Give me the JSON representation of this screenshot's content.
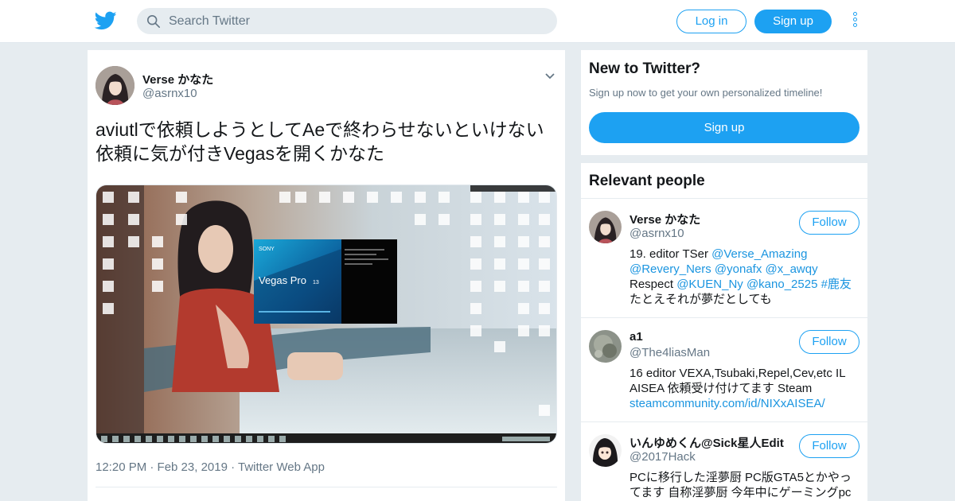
{
  "header": {
    "search_placeholder": "Search Twitter",
    "login_label": "Log in",
    "signup_label": "Sign up",
    "logo_icon": "twitter-bird-icon",
    "accent": "#1da1f2"
  },
  "tweet": {
    "author_name": "Verse かなた",
    "author_handle": "@asrnx10",
    "text": "aviutlで依頼しようとしてAeで終わらせないといけない依頼に気が付きVegasを開くかなた",
    "meta": "12:20 PM · Feb 23, 2019 · Twitter Web App",
    "media": {
      "vegas_brand": "SONY",
      "vegas_title": "Vegas Pro",
      "vegas_version": "13"
    }
  },
  "new_to_twitter": {
    "title": "New to Twitter?",
    "subtitle": "Sign up now to get your own personalized timeline!",
    "button": "Sign up"
  },
  "relevant_people": {
    "title": "Relevant people",
    "follow_label": "Follow",
    "people": [
      {
        "name": "Verse かなた",
        "handle": "@asrnx10",
        "bio_1": "19. editor TSer ",
        "bio_link_1": "@Verse_Amazing",
        "bio_link_2": "@Revery_Ners @yonafx @x_awqy",
        "bio_3": "Respect ",
        "bio_link_3": "@KUEN_Ny @kano_2525 #鹿友",
        "bio_4": "たとえそれが夢だとしても"
      },
      {
        "name": "a1",
        "handle": "@The4liasMan",
        "bio_1": "16 editor VEXA,Tsubaki,Repel,Cev,etc IL",
        "bio_2": "AISEA 依頼受け付けてます Steam",
        "bio_link": "steamcommunity.com/id/NIXxAISEA/"
      },
      {
        "name": "いんゆめくん@Sick星人Edit",
        "handle": "@2017Hack",
        "bio_1": "PCに移行した淫夢厨 PC版GTA5とかやっ",
        "bio_2": "てます 自称淫夢厨 今年中にゲーミングpc"
      }
    ]
  }
}
